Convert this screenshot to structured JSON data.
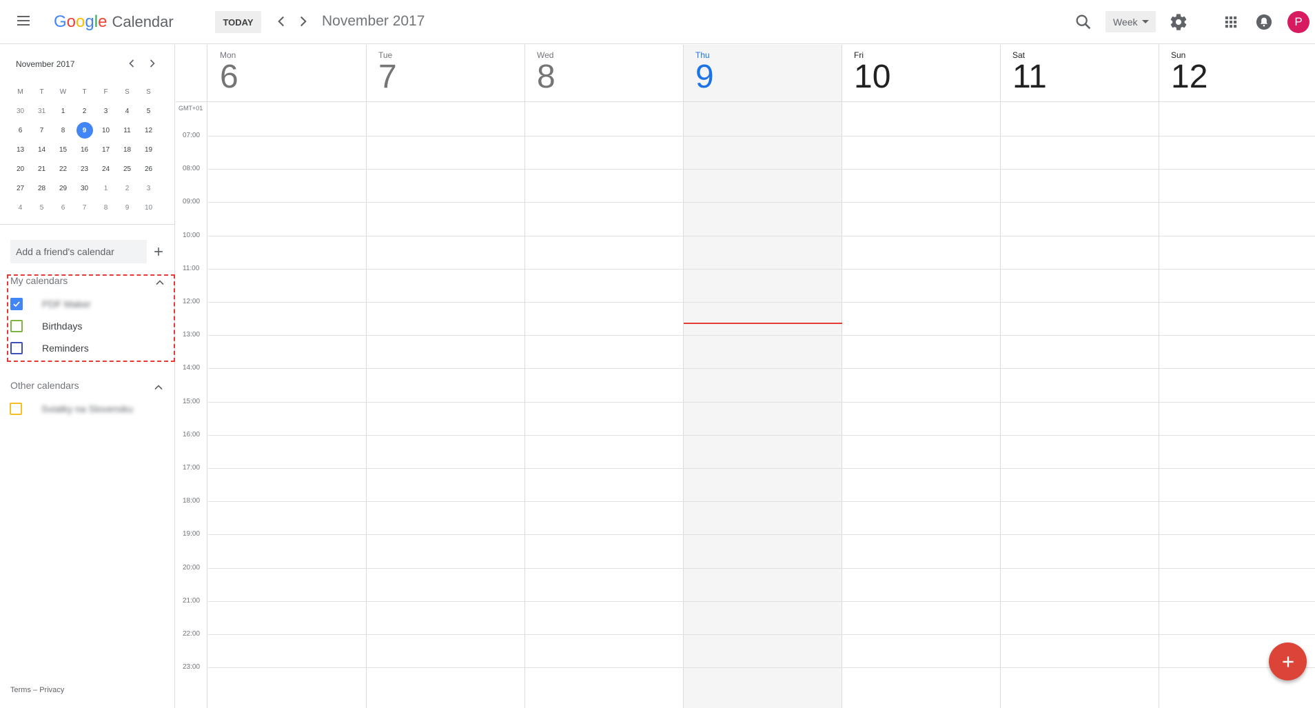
{
  "header": {
    "logo_letters": [
      "G",
      "o",
      "o",
      "g",
      "l",
      "e"
    ],
    "logo_colors": [
      "#4285f4",
      "#ea4335",
      "#fbbc05",
      "#4285f4",
      "#34a853",
      "#ea4335"
    ],
    "app_name": "Calendar",
    "today_label": "TODAY",
    "month_title": "November 2017",
    "view_label": "Week",
    "avatar_initial": "P",
    "icons": [
      "menu-icon",
      "chevron-left-icon",
      "chevron-right-icon",
      "search-icon",
      "gear-icon",
      "apps-grid-icon",
      "notifications-icon"
    ]
  },
  "mini_calendar": {
    "title": "November 2017",
    "weekdays": [
      "M",
      "T",
      "W",
      "T",
      "F",
      "S",
      "S"
    ],
    "weeks": [
      [
        "30",
        "31",
        "1",
        "2",
        "3",
        "4",
        "5"
      ],
      [
        "6",
        "7",
        "8",
        "9",
        "10",
        "11",
        "12"
      ],
      [
        "13",
        "14",
        "15",
        "16",
        "17",
        "18",
        "19"
      ],
      [
        "20",
        "21",
        "22",
        "23",
        "24",
        "25",
        "26"
      ],
      [
        "27",
        "28",
        "29",
        "30",
        "1",
        "2",
        "3"
      ],
      [
        "4",
        "5",
        "6",
        "7",
        "8",
        "9",
        "10"
      ]
    ],
    "selected": "9"
  },
  "sidebar": {
    "friend_placeholder": "Add a friend's calendar",
    "my_calendars": {
      "heading": "My calendars",
      "items": [
        {
          "label": "PDF Maker",
          "checked": true,
          "color": "#4285f4",
          "blurred": true
        },
        {
          "label": "Birthdays",
          "checked": false,
          "color": "#7cb342",
          "blurred": false
        },
        {
          "label": "Reminders",
          "checked": false,
          "color": "#3f51b5",
          "blurred": false
        }
      ]
    },
    "other_calendars": {
      "heading": "Other calendars",
      "items": [
        {
          "label": "Sviatky na Slovensku",
          "checked": false,
          "color": "#f6bf26",
          "blurred": true
        }
      ]
    },
    "footer": {
      "terms": "Terms",
      "separator": " – ",
      "privacy": "Privacy"
    }
  },
  "week": {
    "timezone": "GMT+01",
    "days": [
      {
        "dow": "Mon",
        "date": "6",
        "state": "past"
      },
      {
        "dow": "Tue",
        "date": "7",
        "state": "past"
      },
      {
        "dow": "Wed",
        "date": "8",
        "state": "past"
      },
      {
        "dow": "Thu",
        "date": "9",
        "state": "today"
      },
      {
        "dow": "Fri",
        "date": "10",
        "state": "future"
      },
      {
        "dow": "Sat",
        "date": "11",
        "state": "future"
      },
      {
        "dow": "Sun",
        "date": "12",
        "state": "future"
      }
    ],
    "hours": [
      "07:00",
      "08:00",
      "09:00",
      "10:00",
      "11:00",
      "12:00",
      "13:00",
      "14:00",
      "15:00",
      "16:00",
      "17:00",
      "18:00",
      "19:00",
      "20:00",
      "21:00",
      "22:00",
      "23:00"
    ]
  },
  "fab": {
    "icon": "plus-icon"
  }
}
